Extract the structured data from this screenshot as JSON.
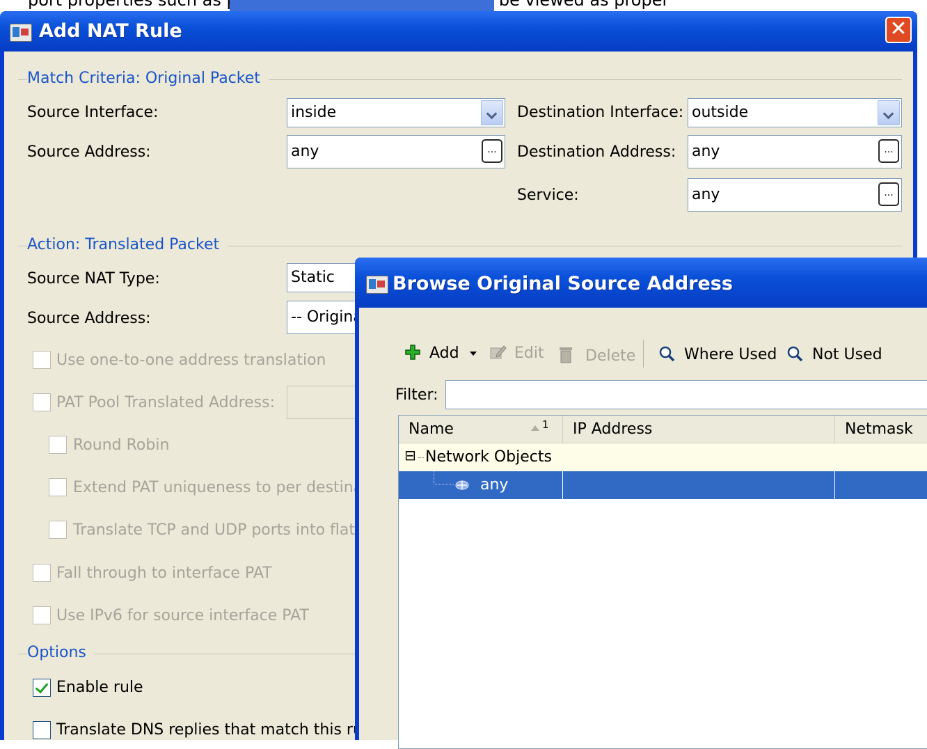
{
  "banner": {
    "text": "port properties such as ports for the configuration, may be viewed as proper"
  },
  "main_window": {
    "title": "Add NAT Rule",
    "close_glyph": "✕",
    "match_section": "Match Criteria: Original Packet",
    "source_interface_label": "Source Interface:",
    "source_interface_value": "inside",
    "destination_interface_label": "Destination Interface:",
    "destination_interface_value": "outside",
    "source_address_label": "Source Address:",
    "source_address_value": "any",
    "destination_address_label": "Destination Address:",
    "destination_address_value": "any",
    "service_label": "Service:",
    "service_value": "any",
    "browse_glyph": "...",
    "action_section": "Action: Translated Packet",
    "source_nat_type_label": "Source NAT Type:",
    "source_nat_type_value": "Static",
    "translated_source_address_label": "Source Address:",
    "translated_source_address_value": "-- Origina",
    "one_to_one_label": "Use one-to-one address translation",
    "pat_pool_label": "PAT Pool Translated Address:",
    "round_robin_label": "Round Robin",
    "extend_pat_label": "Extend PAT uniqueness to per destinal",
    "translate_ports_label": "Translate TCP and UDP ports into flat r",
    "fall_through_label": "Fall through to interface PAT",
    "ipv6_label": "Use IPv6 for source interface PAT",
    "options_section": "Options",
    "enable_rule_label": "Enable rule",
    "enable_rule_checked": true,
    "translate_dns_label": "Translate DNS replies that match this rule"
  },
  "browse_dialog": {
    "title": "Browse Original Source Address",
    "toolbar": {
      "add": "Add",
      "edit": "Edit",
      "delete": "Delete",
      "where_used": "Where Used",
      "not_used": "Not Used"
    },
    "filter_label": "Filter:",
    "filter_value": "",
    "columns": [
      "Name",
      "IP Address",
      "Netmask"
    ],
    "sort_indicator": "1",
    "group": {
      "expander": "⊟",
      "label": "Network Objects"
    },
    "rows": [
      {
        "name": "any",
        "ip": "",
        "netmask": "",
        "selected": true
      }
    ]
  },
  "colors": {
    "titlebar": "#0a50d8",
    "dialog_bg": "#ece9d8",
    "section_text": "#1a55c8",
    "selection": "#316ac5"
  }
}
